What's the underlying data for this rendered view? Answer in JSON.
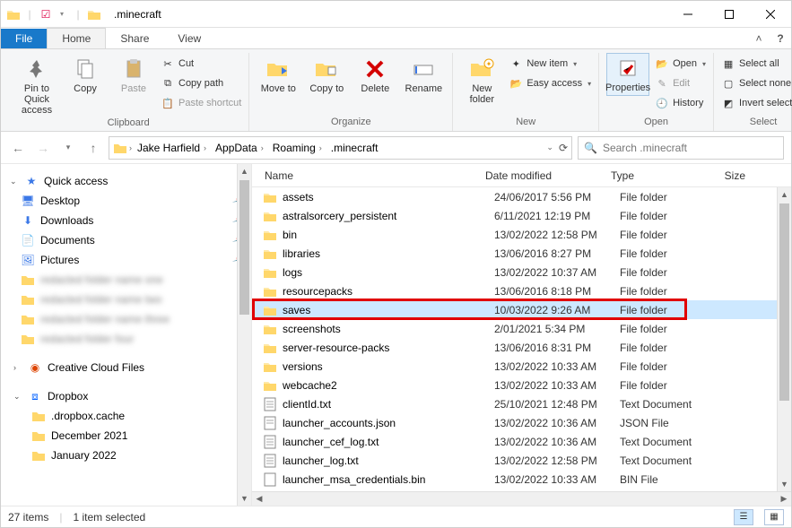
{
  "window": {
    "title": ".minecraft"
  },
  "tabs": {
    "file": "File",
    "home": "Home",
    "share": "Share",
    "view": "View"
  },
  "ribbon": {
    "clipboard": {
      "pin": "Pin to Quick access",
      "copy": "Copy",
      "paste": "Paste",
      "cut": "Cut",
      "copypath": "Copy path",
      "pasteshortcut": "Paste shortcut",
      "label": "Clipboard"
    },
    "organize": {
      "moveto": "Move to",
      "copyto": "Copy to",
      "delete": "Delete",
      "rename": "Rename",
      "label": "Organize"
    },
    "new": {
      "newfolder": "New folder",
      "newitem": "New item",
      "easyaccess": "Easy access",
      "label": "New"
    },
    "open": {
      "properties": "Properties",
      "open": "Open",
      "edit": "Edit",
      "history": "History",
      "label": "Open"
    },
    "select": {
      "selectall": "Select all",
      "selectnone": "Select none",
      "invert": "Invert selection",
      "label": "Select"
    }
  },
  "breadcrumb": [
    "Jake Harfield",
    "AppData",
    "Roaming",
    ".minecraft"
  ],
  "search_placeholder": "Search .minecraft",
  "nav": {
    "quick_access": "Quick access",
    "desktop": "Desktop",
    "downloads": "Downloads",
    "documents": "Documents",
    "pictures": "Pictures",
    "creative": "Creative Cloud Files",
    "dropbox": "Dropbox",
    "dropbox_cache": ".dropbox.cache",
    "dec2021": "December 2021",
    "jan2022": "January 2022"
  },
  "columns": {
    "name": "Name",
    "date": "Date modified",
    "type": "Type",
    "size": "Size"
  },
  "files": [
    {
      "icon": "folder",
      "name": "assets",
      "date": "24/06/2017 5:56 PM",
      "type": "File folder"
    },
    {
      "icon": "folder",
      "name": "astralsorcery_persistent",
      "date": "6/11/2021 12:19 PM",
      "type": "File folder"
    },
    {
      "icon": "folder",
      "name": "bin",
      "date": "13/02/2022 12:58 PM",
      "type": "File folder"
    },
    {
      "icon": "folder",
      "name": "libraries",
      "date": "13/06/2016 8:27 PM",
      "type": "File folder"
    },
    {
      "icon": "folder",
      "name": "logs",
      "date": "13/02/2022 10:37 AM",
      "type": "File folder"
    },
    {
      "icon": "folder",
      "name": "resourcepacks",
      "date": "13/06/2016 8:18 PM",
      "type": "File folder"
    },
    {
      "icon": "folder",
      "name": "saves",
      "date": "10/03/2022 9:26 AM",
      "type": "File folder",
      "selected": true,
      "highlight": true
    },
    {
      "icon": "folder",
      "name": "screenshots",
      "date": "2/01/2021 5:34 PM",
      "type": "File folder"
    },
    {
      "icon": "folder",
      "name": "server-resource-packs",
      "date": "13/06/2016 8:31 PM",
      "type": "File folder"
    },
    {
      "icon": "folder",
      "name": "versions",
      "date": "13/02/2022 10:33 AM",
      "type": "File folder"
    },
    {
      "icon": "folder",
      "name": "webcache2",
      "date": "13/02/2022 10:33 AM",
      "type": "File folder"
    },
    {
      "icon": "txt",
      "name": "clientId.txt",
      "date": "25/10/2021 12:48 PM",
      "type": "Text Document"
    },
    {
      "icon": "json",
      "name": "launcher_accounts.json",
      "date": "13/02/2022 10:36 AM",
      "type": "JSON File"
    },
    {
      "icon": "txt",
      "name": "launcher_cef_log.txt",
      "date": "13/02/2022 10:36 AM",
      "type": "Text Document"
    },
    {
      "icon": "txt",
      "name": "launcher_log.txt",
      "date": "13/02/2022 12:58 PM",
      "type": "Text Document"
    },
    {
      "icon": "bin",
      "name": "launcher_msa_credentials.bin",
      "date": "13/02/2022 10:33 AM",
      "type": "BIN File"
    }
  ],
  "status": {
    "items": "27 items",
    "selected": "1 item selected"
  }
}
